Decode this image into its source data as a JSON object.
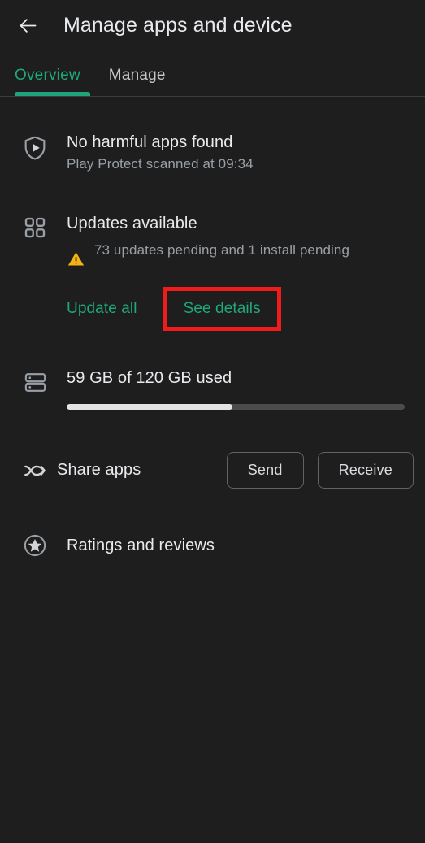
{
  "appbar": {
    "back_icon": "arrow-left-icon",
    "title": "Manage apps and device"
  },
  "tabs": {
    "items": [
      {
        "label": "Overview",
        "active": true
      },
      {
        "label": "Manage",
        "active": false
      }
    ],
    "active_index": 0
  },
  "sections": {
    "play_protect": {
      "icon": "shield-play-icon",
      "title": "No harmful apps found",
      "subtitle": "Play Protect scanned at 09:34"
    },
    "updates": {
      "icon": "app-grid-icon",
      "title": "Updates available",
      "warning_icon": "warning-triangle-icon",
      "subtitle": "73 updates pending and 1 install pending",
      "update_all_label": "Update all",
      "see_details_label": "See details"
    },
    "storage": {
      "icon": "storage-drives-icon",
      "title": "59 GB of 120 GB used",
      "used_gb": 59,
      "total_gb": 120,
      "percent_used": 49
    },
    "share": {
      "icon": "nearby-share-icon",
      "label": "Share apps",
      "send_label": "Send",
      "receive_label": "Receive"
    },
    "ratings": {
      "icon": "star-circle-icon",
      "label": "Ratings and reviews"
    }
  },
  "annotation": {
    "highlight_target": "See details",
    "highlight_color": "#f01b1b"
  },
  "colors": {
    "background": "#1e1e1e",
    "accent_green": "#1fa97b",
    "primary_text": "#e8eaed",
    "secondary_text": "#9aa0a6",
    "warning_amber": "#f5b317",
    "progress_fill": "#e3e3e1",
    "progress_track": "#4a4c4d"
  }
}
